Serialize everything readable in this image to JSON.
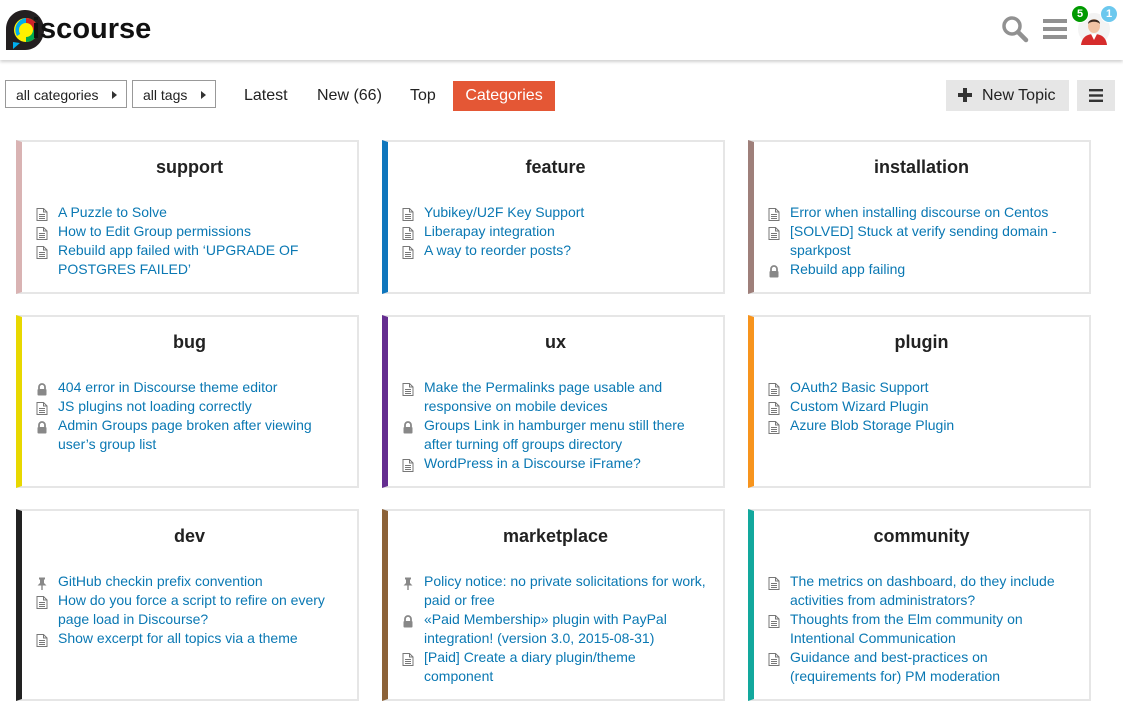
{
  "header": {
    "logo_text": "iscourse",
    "notifications": {
      "green_count": "5",
      "blue_count": "1"
    }
  },
  "nav": {
    "categories_dropdown": "all categories",
    "tags_dropdown": "all tags",
    "latest": "Latest",
    "new": "New (66)",
    "top": "Top",
    "categories": "Categories",
    "new_topic": "New Topic"
  },
  "colors": {
    "accent": "#e45735",
    "link": "#0a78b3",
    "support": "#d9b3b3",
    "feature": "#0e76bd",
    "installation": "#9e7f7a",
    "bug": "#e8d800",
    "ux": "#652d90",
    "plugin": "#f7941d",
    "dev": "#222222",
    "marketplace": "#8c6238",
    "community": "#12a89d"
  },
  "categories": [
    {
      "name": "support",
      "topics": [
        {
          "title": "A Puzzle to Solve",
          "icon": "document-icon"
        },
        {
          "title": "How to Edit Group permissions",
          "icon": "document-icon"
        },
        {
          "title": "Rebuild app failed with ‘UPGRADE OF POSTGRES FAILED’",
          "icon": "document-icon"
        }
      ]
    },
    {
      "name": "feature",
      "topics": [
        {
          "title": "Yubikey/U2F Key Support",
          "icon": "document-icon"
        },
        {
          "title": "Liberapay integration",
          "icon": "document-icon"
        },
        {
          "title": "A way to reorder posts?",
          "icon": "document-icon"
        }
      ]
    },
    {
      "name": "installation",
      "topics": [
        {
          "title": "Error when installing discourse on Centos",
          "icon": "document-icon"
        },
        {
          "title": "[SOLVED] Stuck at verify sending domain - sparkpost",
          "icon": "document-icon"
        },
        {
          "title": "Rebuild app failing",
          "icon": "lock-icon"
        }
      ]
    },
    {
      "name": "bug",
      "topics": [
        {
          "title": "404 error in Discourse theme editor",
          "icon": "lock-icon"
        },
        {
          "title": "JS plugins not loading correctly",
          "icon": "document-icon"
        },
        {
          "title": "Admin Groups page broken after viewing user’s group list",
          "icon": "lock-icon"
        }
      ]
    },
    {
      "name": "ux",
      "topics": [
        {
          "title": "Make the Permalinks page usable and responsive on mobile devices",
          "icon": "document-icon"
        },
        {
          "title": "Groups Link in hamburger menu still there after turning off groups directory",
          "icon": "lock-icon"
        },
        {
          "title": "WordPress in a Discourse iFrame?",
          "icon": "document-icon"
        }
      ]
    },
    {
      "name": "plugin",
      "topics": [
        {
          "title": "OAuth2 Basic Support",
          "icon": "document-icon"
        },
        {
          "title": "Custom Wizard Plugin",
          "icon": "document-icon"
        },
        {
          "title": "Azure Blob Storage Plugin",
          "icon": "document-icon"
        }
      ]
    },
    {
      "name": "dev",
      "topics": [
        {
          "title": "GitHub checkin prefix convention",
          "icon": "pin-icon"
        },
        {
          "title": "How do you force a script to refire on every page load in Discourse?",
          "icon": "document-icon"
        },
        {
          "title": "Show excerpt for all topics via a theme",
          "icon": "document-icon"
        }
      ]
    },
    {
      "name": "marketplace",
      "topics": [
        {
          "title": "Policy notice: no private solicitations for work, paid or free",
          "icon": "pin-icon"
        },
        {
          "title": "«Paid Membership» plugin with PayPal integration! (version 3.0, 2015-08-31)",
          "icon": "lock-icon"
        },
        {
          "title": "[Paid] Create a diary plugin/theme component",
          "icon": "document-icon"
        }
      ]
    },
    {
      "name": "community",
      "topics": [
        {
          "title": "The metrics on dashboard, do they include activities from administrators?",
          "icon": "document-icon"
        },
        {
          "title": "Thoughts from the Elm community on Intentional Communication",
          "icon": "document-icon"
        },
        {
          "title": "Guidance and best-practices on (requirements for) PM moderation",
          "icon": "document-icon"
        }
      ]
    }
  ]
}
